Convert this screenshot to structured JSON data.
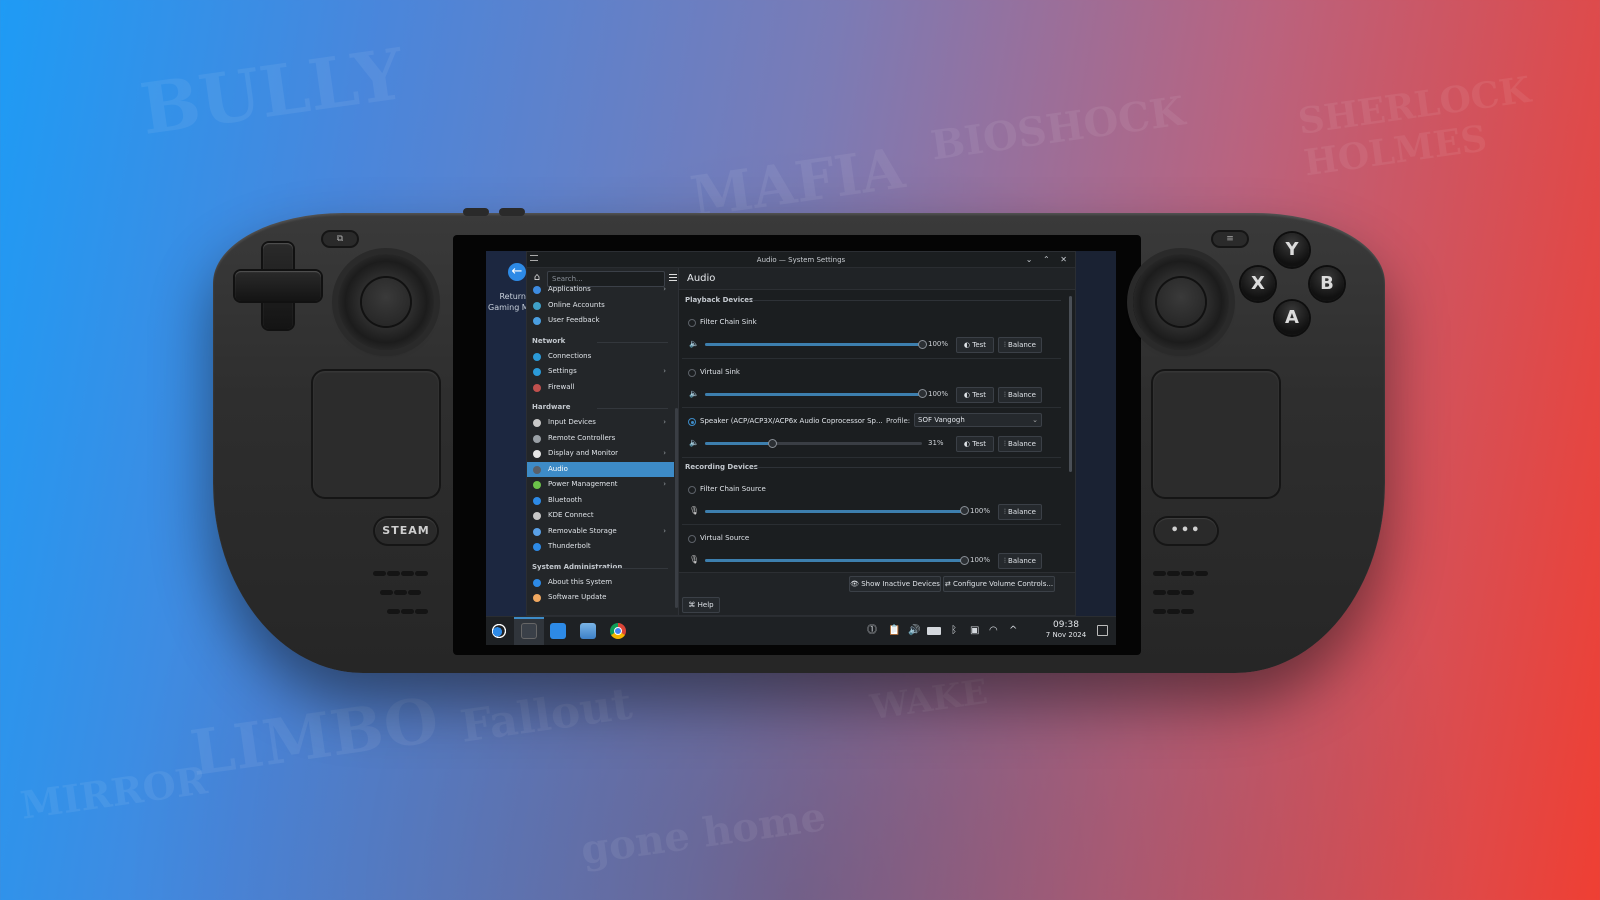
{
  "background": {
    "words": [
      "BULLY",
      "MAFIA",
      "BIOSHOCK",
      "SHERLOCK HOLMES",
      "LIMBO",
      "Fallout",
      "MIRROR",
      "gone home",
      "WAKE",
      "STEAM"
    ]
  },
  "device": {
    "steam_button_label": "STEAM",
    "menu_button_label": "•••",
    "face_buttons": {
      "y": "Y",
      "x": "X",
      "b": "B",
      "a": "A"
    }
  },
  "desktop": {
    "return_label_line1": "Return",
    "return_label_line2": "Gaming Mode"
  },
  "window": {
    "title": "Audio — System Settings",
    "controls": {
      "minimize": "⌄",
      "maximize": "⌃",
      "close": "✕"
    }
  },
  "sidebar": {
    "search_placeholder": "Search...",
    "items": [
      {
        "type": "item",
        "label": "Applications",
        "icon": "applications-icon",
        "color": "#3d8be0",
        "chevron": true
      },
      {
        "type": "item",
        "label": "Online Accounts",
        "icon": "online-accounts-icon",
        "color": "#3fa0c8",
        "chevron": false
      },
      {
        "type": "item",
        "label": "User Feedback",
        "icon": "user-feedback-icon",
        "color": "#4a9ee0",
        "chevron": false
      },
      {
        "type": "category",
        "label": "Network"
      },
      {
        "type": "item",
        "label": "Connections",
        "icon": "connections-icon",
        "color": "#2b9ad8",
        "chevron": false
      },
      {
        "type": "item",
        "label": "Settings",
        "icon": "network-settings-icon",
        "color": "#2b9ad8",
        "chevron": true
      },
      {
        "type": "item",
        "label": "Firewall",
        "icon": "firewall-icon",
        "color": "#c0504d",
        "chevron": false
      },
      {
        "type": "category",
        "label": "Hardware"
      },
      {
        "type": "item",
        "label": "Input Devices",
        "icon": "mouse-icon",
        "color": "#c8c8c8",
        "chevron": true
      },
      {
        "type": "item",
        "label": "Remote Controllers",
        "icon": "gamepad-icon",
        "color": "#9aa0a6",
        "chevron": false
      },
      {
        "type": "item",
        "label": "Display and Monitor",
        "icon": "monitor-icon",
        "color": "#e6e6e6",
        "chevron": true
      },
      {
        "type": "item",
        "label": "Audio",
        "icon": "speaker-icon",
        "color": "#5a6068",
        "chevron": false,
        "active": true
      },
      {
        "type": "item",
        "label": "Power Management",
        "icon": "power-icon",
        "color": "#6cc24a",
        "chevron": true
      },
      {
        "type": "item",
        "label": "Bluetooth",
        "icon": "bluetooth-icon",
        "color": "#2d8ae6",
        "chevron": false
      },
      {
        "type": "item",
        "label": "KDE Connect",
        "icon": "phone-icon",
        "color": "#c8c8c8",
        "chevron": false
      },
      {
        "type": "item",
        "label": "Removable Storage",
        "icon": "usb-icon",
        "color": "#5aa0e6",
        "chevron": true
      },
      {
        "type": "item",
        "label": "Thunderbolt",
        "icon": "thunderbolt-icon",
        "color": "#2d8ae6",
        "chevron": false
      },
      {
        "type": "category",
        "label": "System Administration"
      },
      {
        "type": "item",
        "label": "About this System",
        "icon": "info-icon",
        "color": "#2d8ae6",
        "chevron": false
      },
      {
        "type": "item",
        "label": "Software Update",
        "icon": "update-icon",
        "color": "#f0a860",
        "chevron": false
      }
    ]
  },
  "main": {
    "page_title": "Audio",
    "playback_title": "Playback Devices",
    "recording_title": "Recording Devices",
    "playback": [
      {
        "name": "Filter Chain Sink",
        "selected": false,
        "volume_pct": 100,
        "volume_label": "100%",
        "test_label": "Test",
        "balance_label": "Balance"
      },
      {
        "name": "Virtual Sink",
        "selected": false,
        "volume_pct": 100,
        "volume_label": "100%",
        "test_label": "Test",
        "balance_label": "Balance"
      },
      {
        "name": "Speaker (ACP/ACP3X/ACP6x Audio Coprocessor Sp...",
        "selected": true,
        "volume_pct": 31,
        "volume_label": "31%",
        "test_label": "Test",
        "balance_label": "Balance",
        "profile_label": "Profile:",
        "profile_value": "SOF Vangogh"
      }
    ],
    "recording": [
      {
        "name": "Filter Chain Source",
        "selected": false,
        "volume_pct": 100,
        "volume_label": "100%",
        "balance_label": "Balance"
      },
      {
        "name": "Virtual Source",
        "selected": false,
        "volume_pct": 100,
        "volume_label": "100%",
        "balance_label": "Balance"
      }
    ],
    "show_inactive_label": "Show Inactive Devices",
    "configure_label": "Configure Volume Controls...",
    "help_label": "Help"
  },
  "taskbar": {
    "apps": [
      "steam-icon",
      "system-settings-icon",
      "discover-icon",
      "dolphin-icon",
      "chrome-icon"
    ],
    "time": "09:38",
    "date": "7 Nov 2024"
  },
  "colors": {
    "accent": "#3d8bc7",
    "slider_fill": "#3d7fae"
  }
}
